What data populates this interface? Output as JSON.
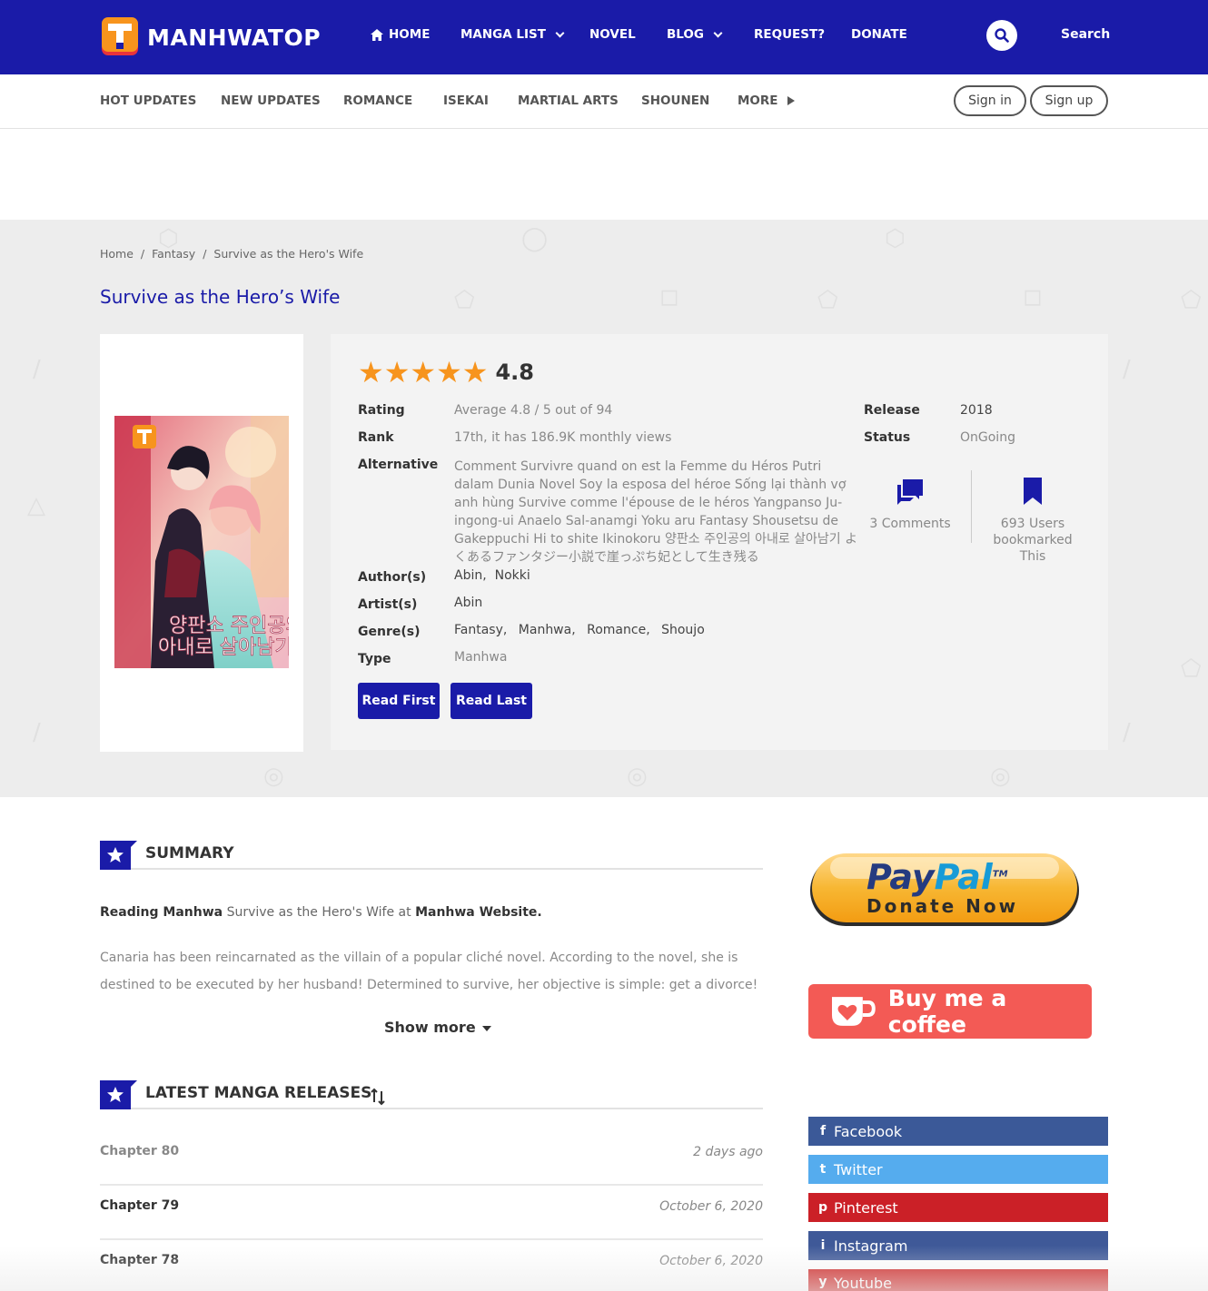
{
  "brand": {
    "name": "MANHWATOP",
    "logo_colors": {
      "orange": "#f7941d",
      "red": "#e8323c"
    }
  },
  "colors": {
    "primary": "#1a1ba8",
    "star": "#f7941d"
  },
  "nav": {
    "items": [
      {
        "label": "HOME",
        "icon": "home-icon"
      },
      {
        "label": "MANGA LIST"
      },
      {
        "label": "NOVEL"
      },
      {
        "label": "BLOG"
      },
      {
        "label": "REQUEST?"
      },
      {
        "label": "DONATE"
      }
    ],
    "search_label": "Search"
  },
  "subnav": {
    "items": [
      "HOT UPDATES",
      "NEW UPDATES",
      "ROMANCE",
      "ISEKAI",
      "MARTIAL ARTS",
      "SHOUNEN",
      "MORE"
    ],
    "sign_in": "Sign in",
    "sign_up": "Sign up"
  },
  "breadcrumb": [
    "Home",
    "/",
    "Fantasy",
    "/",
    "Survive as the Hero's Wife"
  ],
  "title": "Survive as the Hero’s Wife",
  "rating": {
    "score": "4.8",
    "stars": 5
  },
  "details": {
    "rating_label": "Rating",
    "rating_value": "Average 4.8 / 5 out of 94",
    "rank_label": "Rank",
    "rank_value": "17th, it has 186.9K monthly views",
    "alternative_label": "Alternative",
    "alternative_value": "Comment Survivre quand on est la Femme du Héros Putri dalam Dunia Novel Soy la esposa del héroe Sống lại thành vợ anh hùng Survive comme l'épouse de le héros Yangpanso Ju-ingong-ui Anaelo Sal-anamgi Yoku aru Fantasy Shousetsu de Gakeppuchi Hi to shite Ikinokoru 양판소 주인공의 아내로 살아남기 よくあるファンタジー小説で崖っぷち妃として生き残る",
    "authors_label": "Author(s)",
    "authors": [
      "Abin",
      "Nokki"
    ],
    "artists_label": "Artist(s)",
    "artists": "Abin",
    "genres_label": "Genre(s)",
    "genres": [
      "Fantasy",
      "Manhwa",
      "Romance",
      "Shoujo"
    ],
    "type_label": "Type",
    "type_value": "Manhwa",
    "release_label": "Release",
    "release_value": "2018",
    "status_label": "Status",
    "status_value": "OnGoing",
    "comments": "3 Comments",
    "bookmarks": "693 Users bookmarked This"
  },
  "buttons": {
    "read_first": "Read First",
    "read_last": "Read Last"
  },
  "summary": {
    "heading": "SUMMARY",
    "reading_prefix": "Reading Manhwa",
    "reading_title": "Survive as the Hero's Wife",
    "reading_at": "at",
    "reading_site": "Manhwa Website.",
    "text": "Canaria has been reincarnated as the villain of a popular cliché novel. According to the novel, she is destined to be executed by her husband! Determined to survive, her objective is simple: get a divorce!",
    "show_more": "Show more"
  },
  "releases": {
    "heading": "LATEST MANGA RELEASES",
    "chapters": [
      {
        "name": "Chapter 80",
        "date": "2 days ago"
      },
      {
        "name": "Chapter 79",
        "date": "October 6, 2020"
      },
      {
        "name": "Chapter 78",
        "date": "October 6, 2020"
      }
    ]
  },
  "sidebar": {
    "paypal": {
      "brand_pay": "Pay",
      "brand_pal": "Pal",
      "tm": "TM",
      "cta": "Donate Now"
    },
    "coffee": "Buy me a coffee",
    "social": [
      {
        "label": "Facebook",
        "color": "#3b5998",
        "icon": "f"
      },
      {
        "label": "Twitter",
        "color": "#55acee",
        "icon": "t"
      },
      {
        "label": "Pinterest",
        "color": "#cb2027",
        "icon": "p"
      },
      {
        "label": "Instagram",
        "color": "#3f5998",
        "icon": "i"
      },
      {
        "label": "Youtube",
        "color": "#cd201f",
        "icon": "y"
      }
    ]
  }
}
